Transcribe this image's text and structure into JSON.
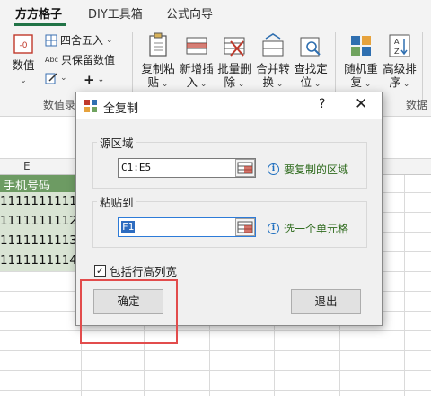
{
  "tabs": [
    "方方格子",
    "DIY工具箱",
    "公式向导"
  ],
  "ribbon": {
    "number_label": "数值",
    "round_label": "四舍五入",
    "keep_value_label": "只保留数值",
    "group_label_left": "数值录",
    "copy_paste_label1": "复制粘",
    "copy_paste_label2": "贴",
    "insert_label1": "新增插",
    "insert_label2": "入",
    "batch_delete_label1": "批量删",
    "batch_delete_label2": "除",
    "merge_label1": "合并转",
    "merge_label2": "换",
    "locate_label1": "查找定",
    "locate_label2": "位",
    "random_label1": "随机重",
    "random_label2": "复",
    "sort_label1": "高级排",
    "sort_label2": "序",
    "group_label_right": "数据"
  },
  "sheet": {
    "column_header": "E",
    "header_cell": "手机号码",
    "rows": [
      "1111111111",
      "1111111112",
      "1111111113",
      "1111111114"
    ]
  },
  "dialog": {
    "title": "全复制",
    "help": "?",
    "close": "✕",
    "source_label": "源区域",
    "source_value": "C1:E5",
    "source_hint": "要复制的区域",
    "paste_label": "粘贴到",
    "paste_value": "F1",
    "paste_hint": "选一个单元格",
    "include_label": "包括行高列宽",
    "include_checked": true,
    "ok_label": "确定",
    "exit_label": "退出"
  },
  "colors": {
    "accent_green": "#217346",
    "header_cell_bg": "#6d9b63",
    "selected_cell_bg": "#d9e4d4",
    "hint_text": "#2f6b1e",
    "highlight_red": "#e24c4c"
  }
}
